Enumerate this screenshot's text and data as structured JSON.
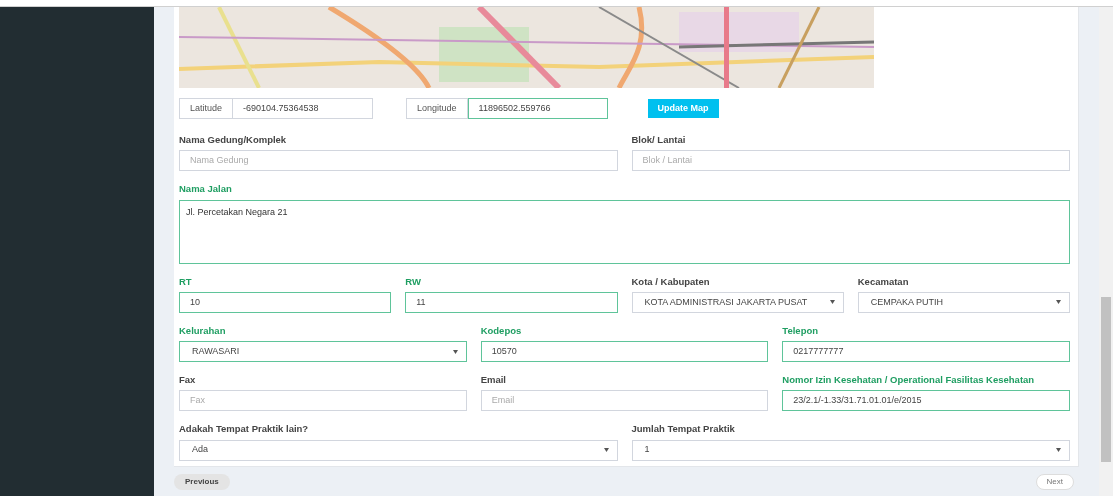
{
  "map": {
    "kind": "picture"
  },
  "coordinates": [
    {
      "label": "Latitude",
      "value": "-690104.75364538",
      "valid": false
    },
    {
      "label": "Longitude",
      "value": "11896502.559766",
      "valid": true
    }
  ],
  "update_button": "Update Map",
  "rows": [
    [
      {
        "label": "Nama Gedung/Komplek",
        "kind": "text",
        "placeholder": "Nama Gedung",
        "valid": false
      },
      {
        "label": "Blok/ Lantai",
        "kind": "text",
        "placeholder": "Blok / Lantai",
        "valid": false
      }
    ],
    [
      {
        "label": "Nama Jalan",
        "kind": "textarea",
        "value": "Jl. Percetakan Negara 21",
        "valid": true
      }
    ],
    [
      {
        "label": "RT",
        "kind": "text",
        "value": "10",
        "valid": true
      },
      {
        "label": "RW",
        "kind": "text",
        "value": "11",
        "valid": true
      },
      {
        "label": "Kota / Kabupaten",
        "kind": "select",
        "value": "KOTA ADMINISTRASI JAKARTA PUSAT",
        "valid": false
      },
      {
        "label": "Kecamatan",
        "kind": "select",
        "value": "CEMPAKA PUTIH",
        "valid": false
      }
    ],
    [
      {
        "label": "Kelurahan",
        "kind": "select",
        "value": "RAWASARI",
        "valid": true
      },
      {
        "label": "Kodepos",
        "kind": "text",
        "value": "10570",
        "valid": true
      },
      {
        "label": "Telepon",
        "kind": "text",
        "value": "0217777777",
        "valid": true
      }
    ],
    [
      {
        "label": "Fax",
        "kind": "text",
        "placeholder": "Fax",
        "valid": false
      },
      {
        "label": "Email",
        "kind": "text",
        "placeholder": "Email",
        "valid": false
      },
      {
        "label": "Nomor Izin Kesehatan / Operational Fasilitas Kesehatan",
        "kind": "text",
        "value": "23/2.1/-1.33/31.71.01.01/e/2015",
        "valid": true
      }
    ],
    [
      {
        "label": "Adakah Tempat Praktik lain?",
        "kind": "select",
        "value": "Ada",
        "valid": false
      },
      {
        "label": "Jumlah Tempat Praktik",
        "kind": "select",
        "value": "1",
        "valid": false
      }
    ]
  ],
  "previous_button": "Previous",
  "next_button": "Next"
}
